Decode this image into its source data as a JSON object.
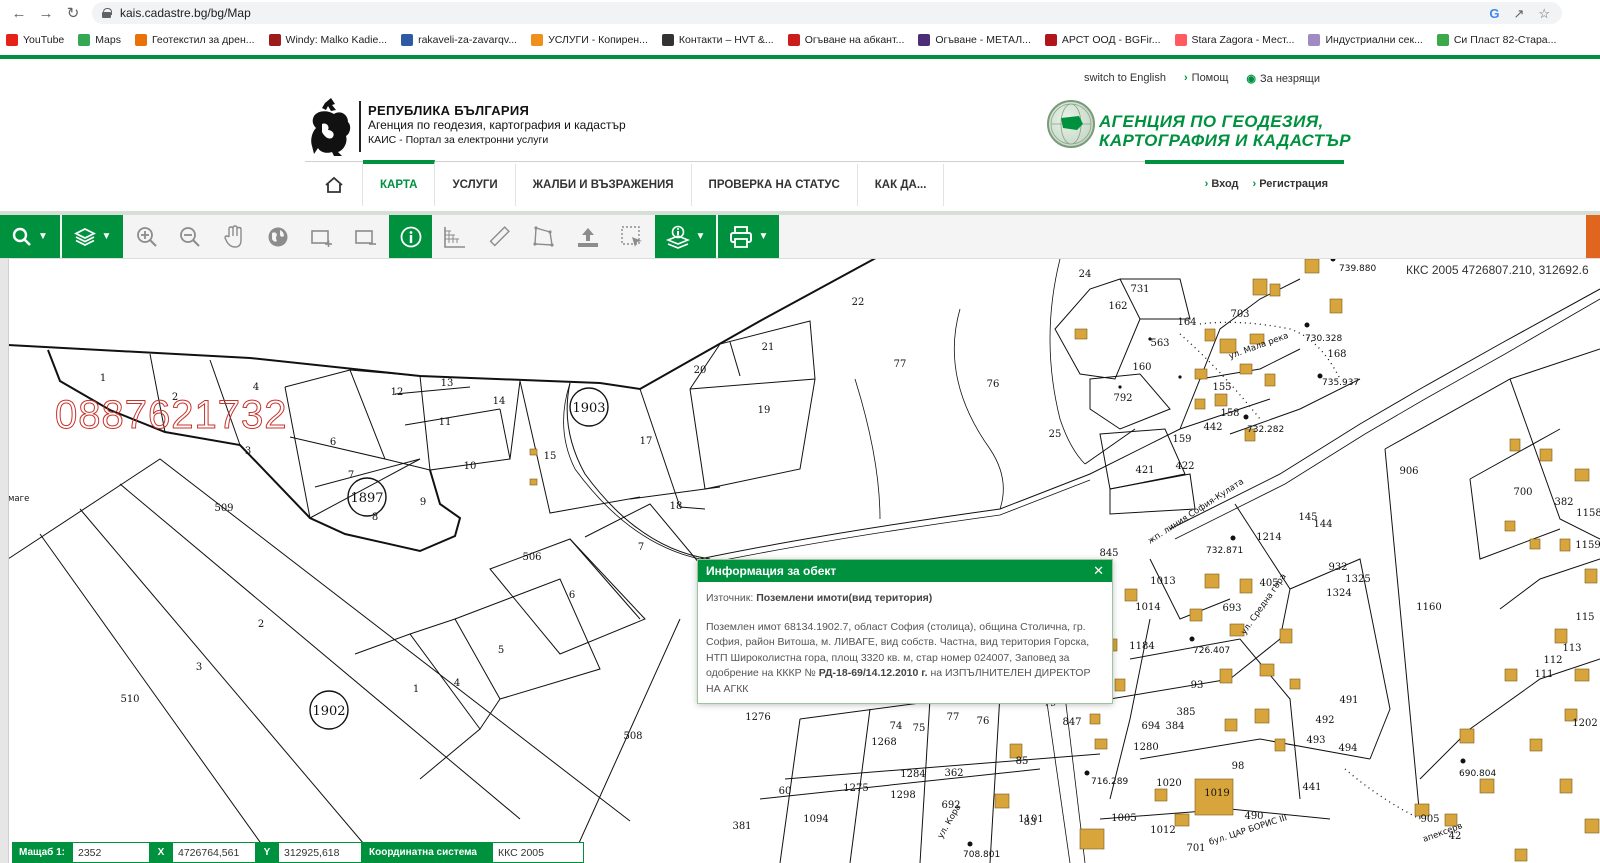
{
  "browser": {
    "url": "kais.cadastre.bg/bg/Map",
    "bookmarks": [
      {
        "label": "YouTube",
        "color": "#e62117"
      },
      {
        "label": "Maps",
        "color": "#34a853"
      },
      {
        "label": "Геотекстил за дрен...",
        "color": "#e8710a"
      },
      {
        "label": "Windy: Malko Kadie...",
        "color": "#9c1c1c"
      },
      {
        "label": "rakaveli-za-zavarqv...",
        "color": "#2d5aa3"
      },
      {
        "label": "УСЛУГИ - Копирен...",
        "color": "#ef8f1c"
      },
      {
        "label": "Контакти – HVT &...",
        "color": "#333333"
      },
      {
        "label": "Огъване на абкант...",
        "color": "#cc1d1d"
      },
      {
        "label": "Огъване - МЕТАЛ...",
        "color": "#4d2d78"
      },
      {
        "label": "АРСТ ООД - BGFir...",
        "color": "#b0151c"
      },
      {
        "label": "Stara Zagora - Мест...",
        "color": "#ff5a5f"
      },
      {
        "label": "Индустриални сек...",
        "color": "#a08ac2"
      },
      {
        "label": "Си Пласт 82-Стара...",
        "color": "#3ba84a"
      }
    ]
  },
  "header": {
    "switch_lang": "switch to English",
    "help": "Помощ",
    "accessibility": "За незрящи",
    "logo_line1": "РЕПУБЛИКА БЪЛГАРИЯ",
    "logo_line2": "Агенция по геодезия, картография и кадастър",
    "logo_line3": "КАИС - Портал за електронни услуги",
    "agency_line1": "АГЕНЦИЯ ПО ГЕОДЕЗИЯ,",
    "agency_line2": "КАРТОГРАФИЯ И КАДАСТЪР"
  },
  "nav": {
    "items": [
      "КАРТА",
      "УСЛУГИ",
      "ЖАЛБИ И ВЪЗРАЖЕНИЯ",
      "ПРОВЕРКА НА СТАТУС",
      "КАК ДА..."
    ],
    "login": "Вход",
    "register": "Регистрация"
  },
  "map": {
    "coord_readout": "ККС 2005 4726807.210, 312692.6",
    "watermark_phone": "0887621732",
    "circled_labels": [
      "1903",
      "1897",
      "1902"
    ]
  },
  "info_popup": {
    "title": "Информация за обект",
    "source_label": "Източник:",
    "source_value": "Поземлени имоти(вид територия)",
    "description_1": "Поземлен имот 68134.1902.7, област София (столица), община Столична, гр. София, район Витоша, м. ЛИВАГЕ, вид собств. Частна, вид територия Горска, НТП Широколистна гора, площ 3320 кв. м, стар номер 024007, Заповед за одобрение на КККР №",
    "order_no": "РД-18-69/14.12.2010 г.",
    "description_2": "на ИЗПЪЛНИТЕЛЕН ДИРЕКТОР НА АГКК"
  },
  "status_bar": {
    "scale_label": "Мащаб 1:",
    "scale_value": "2352",
    "x_label": "X",
    "x_value": "4726764,561",
    "y_label": "Y",
    "y_value": "312925,618",
    "crs_label": "Координатна система",
    "crs_value": "ККС 2005"
  },
  "colors": {
    "brand_green": "#00913f",
    "orange": "#e0661f",
    "building": "#d8a53c"
  }
}
